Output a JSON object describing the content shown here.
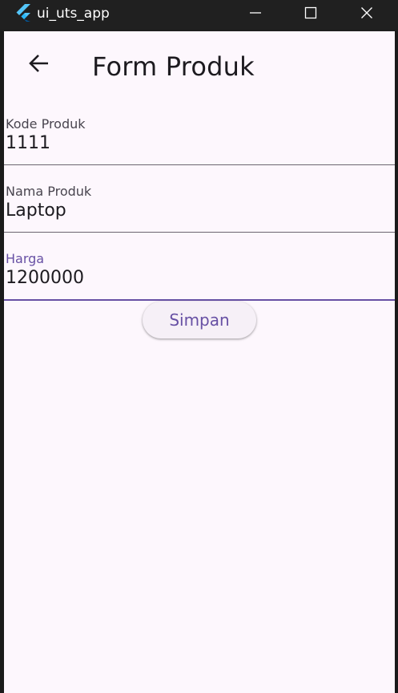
{
  "window": {
    "title": "ui_uts_app",
    "icon": "flutter-logo",
    "controls": {
      "minimize_icon": "minimize-icon",
      "maximize_icon": "maximize-icon",
      "close_icon": "close-icon"
    }
  },
  "appbar": {
    "back_icon": "arrow-left-icon",
    "title": "Form Produk"
  },
  "form": {
    "fields": [
      {
        "label": "Kode Produk",
        "value": "1111",
        "focused": false
      },
      {
        "label": "Nama Produk",
        "value": "Laptop",
        "focused": false
      },
      {
        "label": "Harga",
        "value": "1200000",
        "focused": true
      }
    ],
    "submit_label": "Simpan"
  },
  "colors": {
    "accent": "#6750a4",
    "background": "#fdf7fd",
    "titlebar": "#202020",
    "text": "#1d1b20",
    "label": "#49454f"
  }
}
